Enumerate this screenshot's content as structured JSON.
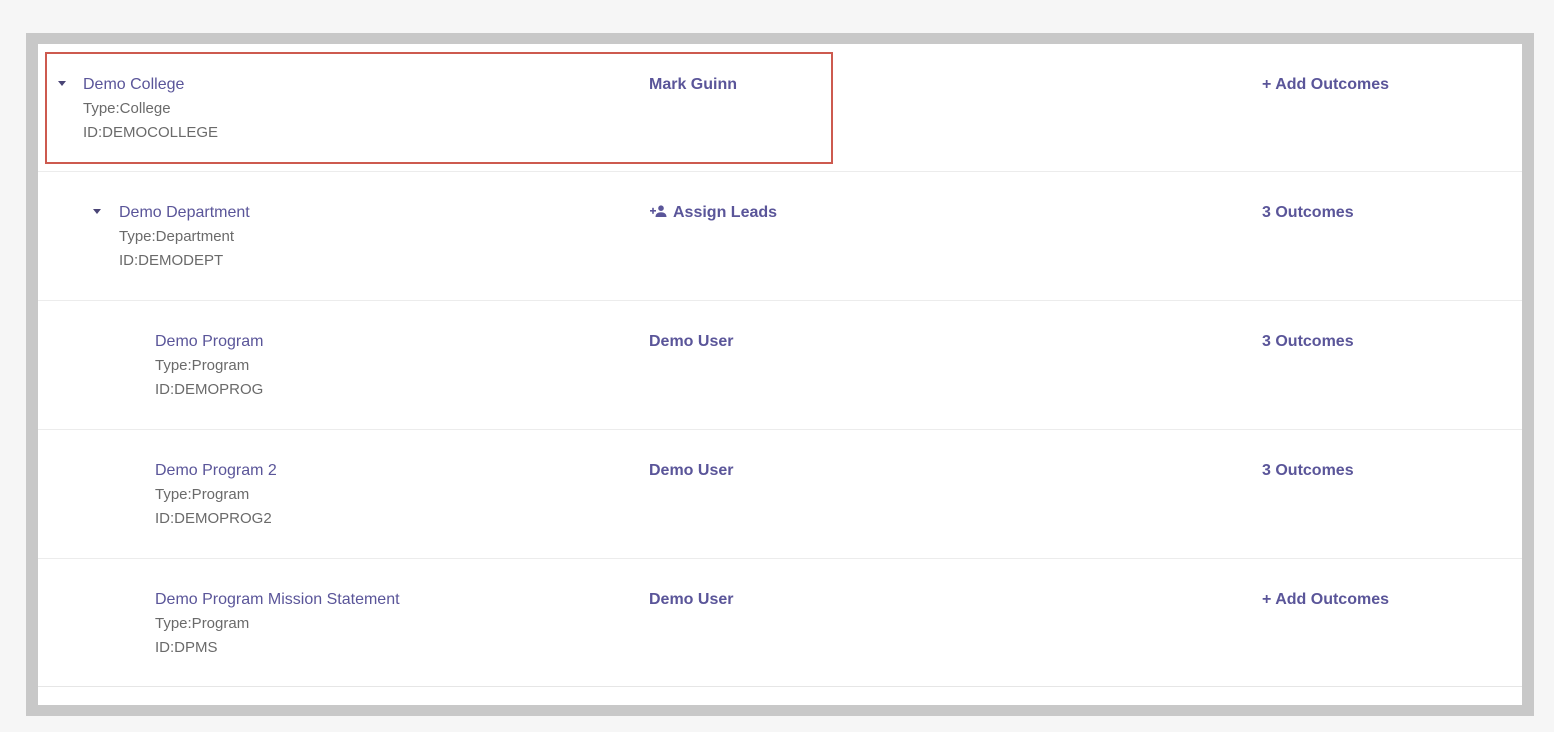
{
  "rows": [
    {
      "name": "Demo College",
      "type": "Type:College",
      "id": "ID:DEMOCOLLEGE",
      "lead": "Mark Guinn",
      "outcomes": "+ Add Outcomes"
    },
    {
      "name": "Demo Department",
      "type": "Type:Department",
      "id": "ID:DEMODEPT",
      "lead": "Assign Leads",
      "outcomes": "3 Outcomes"
    },
    {
      "name": "Demo Program",
      "type": "Type:Program",
      "id": "ID:DEMOPROG",
      "lead": "Demo User",
      "outcomes": "3 Outcomes"
    },
    {
      "name": "Demo Program 2",
      "type": "Type:Program",
      "id": "ID:DEMOPROG2",
      "lead": "Demo User",
      "outcomes": "3 Outcomes"
    },
    {
      "name": "Demo Program Mission Statement",
      "type": "Type:Program",
      "id": "ID:DPMS",
      "lead": "Demo User",
      "outcomes": "+ Add Outcomes"
    }
  ],
  "icons": {
    "expand": "caret-down-icon",
    "assign": "add-user-icon"
  },
  "colors": {
    "accent": "#5a5599",
    "highlight": "#cd5a4f",
    "meta_text": "#6a6a6a"
  }
}
